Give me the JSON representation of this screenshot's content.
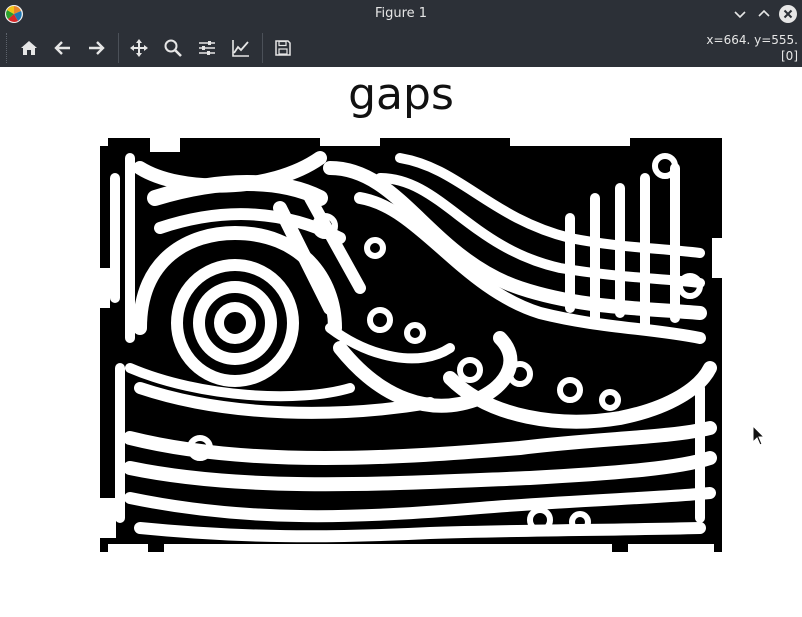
{
  "window": {
    "title": "Figure 1",
    "app_icon": "matplotlib-logo-icon",
    "controls": [
      "minimize-icon",
      "maximize-icon",
      "close-icon"
    ]
  },
  "toolbar": {
    "buttons": [
      {
        "name": "home",
        "icon": "home-icon"
      },
      {
        "name": "back",
        "icon": "arrow-left-icon"
      },
      {
        "name": "forward",
        "icon": "arrow-right-icon"
      },
      {
        "name": "pan",
        "icon": "move-icon"
      },
      {
        "name": "zoom",
        "icon": "magnifier-icon"
      },
      {
        "name": "configure-subplots",
        "icon": "sliders-icon"
      },
      {
        "name": "edit-axis",
        "icon": "line-chart-icon"
      },
      {
        "name": "save",
        "icon": "floppy-disk-icon"
      }
    ],
    "coords_line1": "x=664. y=555.",
    "coords_line2": "[0]"
  },
  "figure": {
    "title": "gaps",
    "image_description_colors": {
      "foreground": "#ffffff",
      "background": "#000000"
    }
  }
}
